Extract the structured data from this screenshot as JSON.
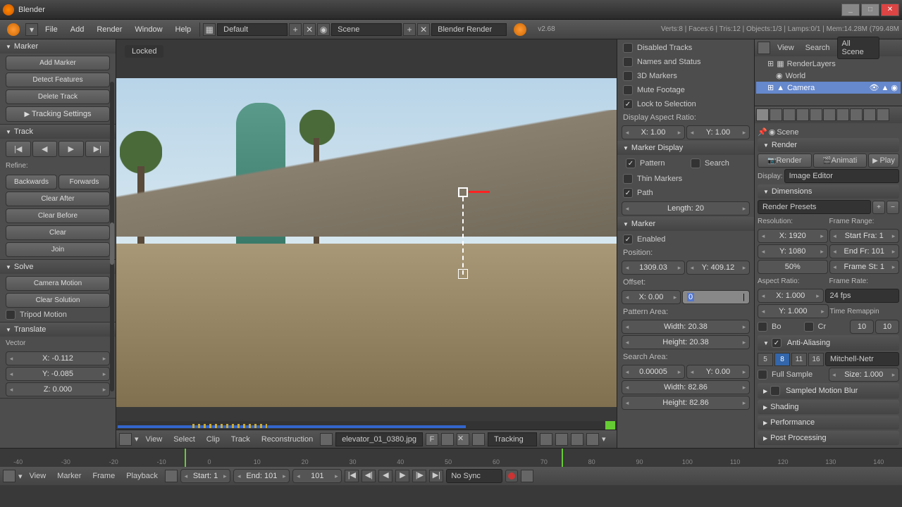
{
  "app": {
    "title": "Blender",
    "version": "v2.68"
  },
  "stats": "Verts:8 | Faces:6 | Tris:12 | Objects:1/3 | Lamps:0/1 | Mem:14.28M (799.48M",
  "menu": {
    "file": "File",
    "add": "Add",
    "render": "Render",
    "window": "Window",
    "help": "Help"
  },
  "header": {
    "layout": "Default",
    "scene": "Scene",
    "engine": "Blender Render"
  },
  "left": {
    "marker_hdr": "Marker",
    "add_marker": "Add Marker",
    "detect_features": "Detect Features",
    "delete_track": "Delete Track",
    "tracking_settings": "Tracking Settings",
    "track_hdr": "Track",
    "refine": "Refine:",
    "backwards": "Backwards",
    "forwards": "Forwards",
    "clear_after": "Clear After",
    "clear_before": "Clear Before",
    "clear": "Clear",
    "join": "Join",
    "solve_hdr": "Solve",
    "camera_motion": "Camera Motion",
    "clear_solution": "Clear Solution",
    "tripod_motion": "Tripod Motion",
    "translate_hdr": "Translate",
    "vector": "Vector",
    "vec_x": "X: -0.112",
    "vec_y": "Y: -0.085",
    "vec_z": "Z: 0.000"
  },
  "viewport": {
    "locked": "Locked"
  },
  "clip_bar": {
    "view": "View",
    "select": "Select",
    "clip": "Clip",
    "track": "Track",
    "reconstruction": "Reconstruction",
    "filename": "elevator_01_0380.jpg",
    "f": "F",
    "mode": "Tracking"
  },
  "track_panel": {
    "disabled_tracks": "Disabled Tracks",
    "names_status": "Names and Status",
    "markers_3d": "3D Markers",
    "mute_footage": "Mute Footage",
    "lock_selection": "Lock to Selection",
    "display_aspect": "Display Aspect Ratio:",
    "aspect_x": "X: 1.00",
    "aspect_y": "Y: 1.00",
    "marker_display_hdr": "Marker Display",
    "pattern": "Pattern",
    "search": "Search",
    "thin_markers": "Thin Markers",
    "path": "Path",
    "length": "Length: 20",
    "marker_hdr": "Marker",
    "enabled": "Enabled",
    "position": "Position:",
    "pos_x": "1309.03",
    "pos_y": "Y: 409.12",
    "offset": "Offset:",
    "off_x": "X: 0.00",
    "off_y_edit": "0",
    "pattern_area": "Pattern Area:",
    "pat_w": "Width: 20.38",
    "pat_h": "Height: 20.38",
    "search_area": "Search Area:",
    "search_x": "0.00005",
    "search_y": "Y: 0.00",
    "search_w": "Width: 82.86",
    "search_h": "Height: 82.86"
  },
  "outliner": {
    "view": "View",
    "search": "Search",
    "all_scenes": "All Scene",
    "render_layers": "RenderLayers",
    "world": "World",
    "camera": "Camera"
  },
  "props": {
    "scene": "Scene",
    "render_hdr": "Render",
    "render_btn": "Render",
    "animation_btn": "Animati",
    "play_btn": "Play",
    "display": "Display:",
    "display_mode": "Image Editor",
    "dimensions_hdr": "Dimensions",
    "render_presets": "Render Presets",
    "resolution": "Resolution:",
    "frame_range": "Frame Range:",
    "res_x": "X: 1920",
    "res_y": "Y: 1080",
    "res_pct": "50%",
    "start_fra": "Start Fra: 1",
    "end_fr": "End Fr: 101",
    "frame_st": "Frame St: 1",
    "aspect_ratio": "Aspect Ratio:",
    "frame_rate": "Frame Rate:",
    "ar_x": "X: 1.000",
    "ar_y": "Y: 1.000",
    "fps": "24 fps",
    "time_remap": "Time Remappin",
    "bo": "Bo",
    "cr": "Cr",
    "remap_old": "10",
    "remap_new": "10",
    "aa_hdr": "Anti-Aliasing",
    "aa_5": "5",
    "aa_8": "8",
    "aa_11": "11",
    "aa_16": "16",
    "aa_filter": "Mitchell-Netr",
    "full_sample": "Full Sample",
    "aa_size": "Size: 1.000",
    "motion_blur_hdr": "Sampled Motion Blur",
    "shading_hdr": "Shading",
    "performance_hdr": "Performance",
    "post_hdr": "Post Processing"
  },
  "timeline": {
    "marks": [
      "-40",
      "-30",
      "-20",
      "-10",
      "0",
      "10",
      "20",
      "30",
      "40",
      "50",
      "60",
      "70",
      "80",
      "90",
      "100",
      "110",
      "120",
      "130",
      "140"
    ],
    "view": "View",
    "marker": "Marker",
    "frame": "Frame",
    "playback": "Playback",
    "start": "Start: 1",
    "end": "End: 101",
    "current": "101",
    "sync": "No Sync"
  }
}
